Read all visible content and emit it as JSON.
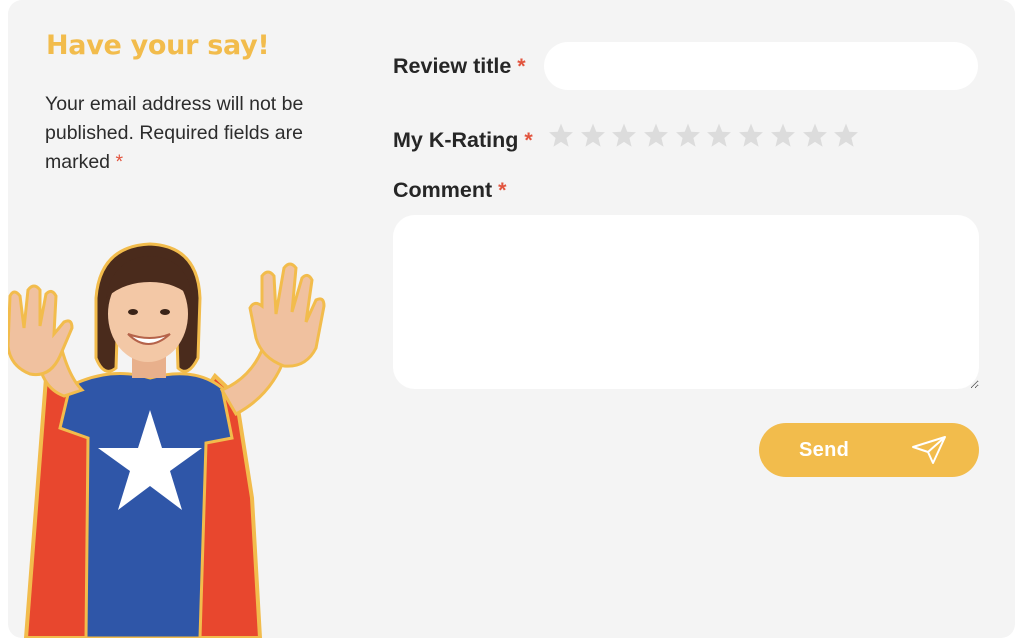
{
  "aside": {
    "heading": "Have your say!",
    "intro_text": "Your email address will not be published. Required fields are marked",
    "required_marker": "*"
  },
  "form": {
    "review_title": {
      "label": "Review title",
      "required_marker": "*",
      "value": "",
      "placeholder": ""
    },
    "rating": {
      "label": "My K-Rating",
      "required_marker": "*",
      "max_stars": 10,
      "selected": 0,
      "star_icon": "star-icon"
    },
    "comment": {
      "label": "Comment",
      "required_marker": "*",
      "value": "",
      "placeholder": ""
    },
    "send_button": {
      "label": "Send",
      "icon": "paper-plane-icon"
    }
  },
  "colors": {
    "accent": "#f2bc4c",
    "required": "#e2553f",
    "star_empty": "#dcdcdc",
    "card_background": "#f4f4f4",
    "field_background": "#ffffff"
  }
}
